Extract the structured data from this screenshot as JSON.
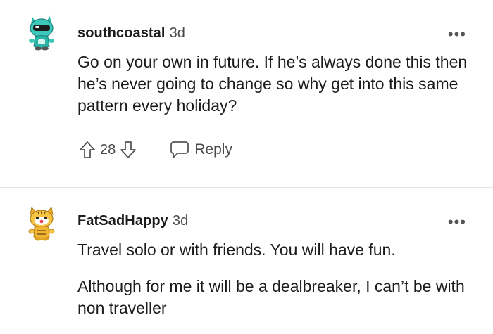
{
  "comments": [
    {
      "username": "southcoastal",
      "age": "3d",
      "paragraphs": [
        "Go on your own in future. If he’s always done this then he’s never going to change so why get into this same pattern every holiday?"
      ],
      "score": "28",
      "reply_label": "Reply",
      "more_label": "•••",
      "avatar_icon": "snoo-avatar-teal-icon",
      "accent_color": "#2bb5a8"
    },
    {
      "username": "FatSadHappy",
      "age": "3d",
      "paragraphs": [
        "Travel solo or with friends. You will have fun.",
        "Although for me it will be a dealbreaker, I can’t be with non traveller"
      ],
      "more_label": "•••",
      "avatar_icon": "snoo-avatar-tiger-icon",
      "accent_color": "#f2b531"
    }
  ]
}
